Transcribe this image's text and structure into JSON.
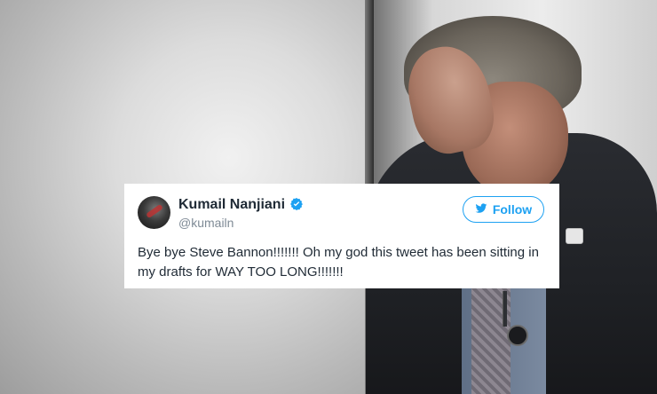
{
  "tweet": {
    "display_name": "Kumail Nanjiani",
    "handle": "@kumailn",
    "follow_label": "Follow",
    "text": "Bye bye Steve Bannon!!!!!!! Oh my god this tweet has been sitting in my drafts for WAY TOO LONG!!!!!!!",
    "icons": {
      "verified": "verified-badge-icon",
      "follow": "twitter-bird-icon"
    },
    "colors": {
      "accent": "#1da1f2",
      "name": "#1f2a35",
      "handle": "#7f8b96"
    }
  }
}
